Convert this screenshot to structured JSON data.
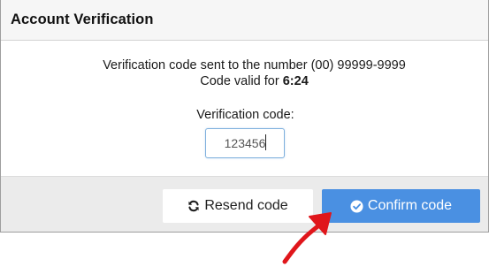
{
  "dialog": {
    "title": "Account Verification"
  },
  "message": {
    "sent_prefix": "Verification code sent to the number",
    "phone_number": "(00) 99999-9999",
    "valid_prefix": "Code valid for",
    "time_remaining": "6:24"
  },
  "form": {
    "code_label": "Verification code:",
    "code_value": "123456"
  },
  "footer": {
    "resend_label": "Resend code",
    "confirm_label": "Confirm code"
  },
  "icons": {
    "resend": "refresh-icon",
    "confirm": "check-circle-icon",
    "annotation": "red-arrow"
  },
  "colors": {
    "confirm_button": "#4a90e2",
    "annotation_arrow": "#e0161b"
  }
}
